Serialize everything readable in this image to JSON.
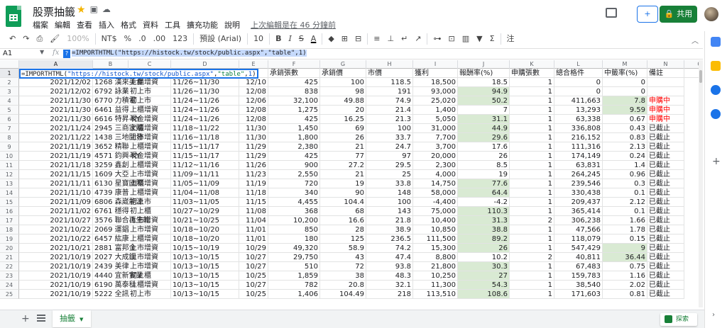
{
  "header": {
    "doc_title": "股票抽籤",
    "menus": [
      "檔案",
      "編輯",
      "查看",
      "插入",
      "格式",
      "資料",
      "工具",
      "擴充功能",
      "說明"
    ],
    "last_edit": "上次編輯是在 46 分鐘前",
    "share_label": "共用",
    "present_label": "+"
  },
  "toolbar": {
    "zoom": "100%",
    "currency": "NT$",
    "percent": "%",
    "dec_dec": ".0",
    "dec_inc": ".00",
    "more_formats": "123",
    "font": "預設 (Arial)",
    "font_size": "10",
    "bold": "B",
    "italic": "I",
    "strike": "S",
    "text_color": "A",
    "sum": "Σ",
    "note": "注"
  },
  "formula_bar": {
    "cell_ref": "A1",
    "fx": "fx",
    "formula": "=IMPORTHTML(\"https://histock.tw/stock/public.aspx\",\"table\",1)"
  },
  "active_cell": {
    "p1": "=IMPORTHTML(",
    "p2": "\"https://histock.tw/stock/public.aspx\"",
    "p3": ",",
    "p4": "\"table\"",
    "p5": ",",
    "p6": "1",
    "p7": ")"
  },
  "columns": [
    "A",
    "B",
    "C",
    "D",
    "E",
    "F",
    "G",
    "H",
    "I",
    "J",
    "K",
    "L",
    "M",
    "N",
    "O"
  ],
  "header_row": [
    "",
    "",
    "",
    "",
    "日期",
    "承銷張數",
    "承銷價",
    "市價",
    "獲利",
    "報酬率(%)",
    "申購張數",
    "總合格件",
    "中籤率(%)",
    "備註",
    ""
  ],
  "rows": [
    [
      "2021/12/02",
      "1268 漢來美食",
      "上櫃增資",
      "11/26~11/30",
      "12/10",
      "425",
      "100",
      "118.5",
      "18,500",
      "18.5",
      "1",
      "0",
      "0",
      ""
    ],
    [
      "2021/12/02",
      "6792 詠業",
      "初上市",
      "11/26~11/30",
      "12/08",
      "838",
      "98",
      "191",
      "93,000",
      "94.9",
      "1",
      "0",
      "0",
      ""
    ],
    [
      "2021/11/30",
      "6770 力積電",
      "初上市",
      "11/24~11/26",
      "12/06",
      "32,100",
      "49.88",
      "74.9",
      "25,020",
      "50.2",
      "1",
      "411,663",
      "7.8",
      "申購中"
    ],
    [
      "2021/11/30",
      "6461 益得",
      "上櫃增資",
      "11/24~11/26",
      "12/08",
      "1,275",
      "20",
      "21.4",
      "1,400",
      "7",
      "1",
      "13,293",
      "9.59",
      "申購中"
    ],
    [
      "2021/11/30",
      "6616 特昇-KY",
      "現金增資",
      "11/24~11/26",
      "12/08",
      "425",
      "16.25",
      "21.3",
      "5,050",
      "31.1",
      "1",
      "63,338",
      "0.67",
      "申購中"
    ],
    [
      "2021/11/24",
      "2945 三商家購",
      "上櫃增資",
      "11/18~11/22",
      "11/30",
      "1,450",
      "69",
      "100",
      "31,000",
      "44.9",
      "1",
      "336,808",
      "0.43",
      "已截止"
    ],
    [
      "2021/11/22",
      "1438 三地開發",
      "上市增資",
      "11/16~11/18",
      "11/30",
      "1,800",
      "26",
      "33.7",
      "7,700",
      "29.6",
      "1",
      "216,152",
      "0.83",
      "已截止"
    ],
    [
      "2021/11/19",
      "3652 精聯",
      "上櫃增資",
      "11/15~11/17",
      "11/29",
      "2,380",
      "21",
      "24.7",
      "3,700",
      "17.6",
      "1",
      "111,316",
      "2.13",
      "已截止"
    ],
    [
      "2021/11/19",
      "4571 鈞興-KY",
      "現金增資",
      "11/15~11/17",
      "11/29",
      "425",
      "77",
      "97",
      "20,000",
      "26",
      "1",
      "174,149",
      "0.24",
      "已截止"
    ],
    [
      "2021/11/18",
      "3259 鑫創",
      "上櫃增資",
      "11/12~11/16",
      "11/26",
      "900",
      "27.2",
      "29.5",
      "2,300",
      "8.5",
      "1",
      "63,831",
      "1.4",
      "已截止"
    ],
    [
      "2021/11/15",
      "1609 大亞",
      "上市增資",
      "11/09~11/11",
      "11/23",
      "2,550",
      "21",
      "25",
      "4,000",
      "19",
      "1",
      "264,245",
      "0.96",
      "已截止"
    ],
    [
      "2021/11/11",
      "6130 星寶國際",
      "上櫃增資",
      "11/05~11/09",
      "11/19",
      "720",
      "19",
      "33.8",
      "14,750",
      "77.6",
      "1",
      "239,546",
      "0.3",
      "已截止"
    ],
    [
      "2021/11/10",
      "4739 康普",
      "上櫃增資",
      "11/04~11/08",
      "11/18",
      "340",
      "90",
      "148",
      "58,000",
      "64.4",
      "1",
      "330,438",
      "0.1",
      "已截止"
    ],
    [
      "2021/11/09",
      "6806 森崴能源",
      "初上市",
      "11/03~11/05",
      "11/15",
      "4,455",
      "104.4",
      "100",
      "-4,400",
      "-4.2",
      "1",
      "209,437",
      "2.12",
      "已截止"
    ],
    [
      "2021/11/02",
      "6761 穩得",
      "初上櫃",
      "10/27~10/29",
      "11/08",
      "368",
      "68",
      "143",
      "75,000",
      "110.3",
      "1",
      "365,414",
      "0.1",
      "已截止"
    ],
    [
      "2021/10/27",
      "3576 聯合再生能",
      "上市增資",
      "10/21~10/25",
      "11/04",
      "10,200",
      "16.6",
      "21.8",
      "10,400",
      "31.3",
      "2",
      "306,238",
      "1.66",
      "已截止"
    ],
    [
      "2021/10/22",
      "2069 運錩",
      "上市增資",
      "10/18~10/20",
      "11/01",
      "850",
      "28",
      "38.9",
      "10,850",
      "38.8",
      "1",
      "47,566",
      "1.78",
      "已截止"
    ],
    [
      "2021/10/22",
      "6457 紘康",
      "上櫃增資",
      "10/18~10/20",
      "11/01",
      "180",
      "125",
      "236.5",
      "111,500",
      "89.2",
      "1",
      "118,079",
      "0.15",
      "已截止"
    ],
    [
      "2021/10/21",
      "2881 富邦金",
      "上市增資",
      "10/15~10/19",
      "10/29",
      "49,320",
      "58.9",
      "74.2",
      "15,300",
      "26",
      "1",
      "547,429",
      "9",
      "已截止"
    ],
    [
      "2021/10/19",
      "2027 大成鋼",
      "上市增資",
      "10/13~10/15",
      "10/27",
      "29,750",
      "43",
      "47.4",
      "8,800",
      "10.2",
      "2",
      "40,811",
      "36.44",
      "已截止"
    ],
    [
      "2021/10/19",
      "2439 美律",
      "上市增資",
      "10/13~10/15",
      "10/27",
      "510",
      "72",
      "93.8",
      "21,800",
      "30.3",
      "1",
      "67,483",
      "0.75",
      "已截止"
    ],
    [
      "2021/10/19",
      "4440 宜新實業",
      "初上櫃",
      "10/13~10/15",
      "10/25",
      "1,859",
      "38",
      "48.3",
      "10,250",
      "27",
      "1",
      "159,783",
      "1.16",
      "已截止"
    ],
    [
      "2021/10/19",
      "6190 萬泰科",
      "上櫃增資",
      "10/13~10/15",
      "10/27",
      "782",
      "20.8",
      "32.1",
      "11,300",
      "54.3",
      "1",
      "38,540",
      "2.02",
      "已截止"
    ],
    [
      "2021/10/19",
      "5222 全訊",
      "初上市",
      "10/13~10/15",
      "10/25",
      "1,406",
      "104.49",
      "218",
      "113,510",
      "108.6",
      "1",
      "171,603",
      "0.81",
      "已截止"
    ]
  ],
  "green_j_rows": [
    1,
    2,
    4,
    5,
    6,
    11,
    12,
    14,
    15,
    16,
    17,
    18,
    20,
    21,
    22,
    23
  ],
  "green_m_rows": [
    2,
    3,
    18,
    19
  ],
  "sheets": {
    "tab_label": "抽籤",
    "add_label": "+",
    "explore_label": "探索"
  }
}
